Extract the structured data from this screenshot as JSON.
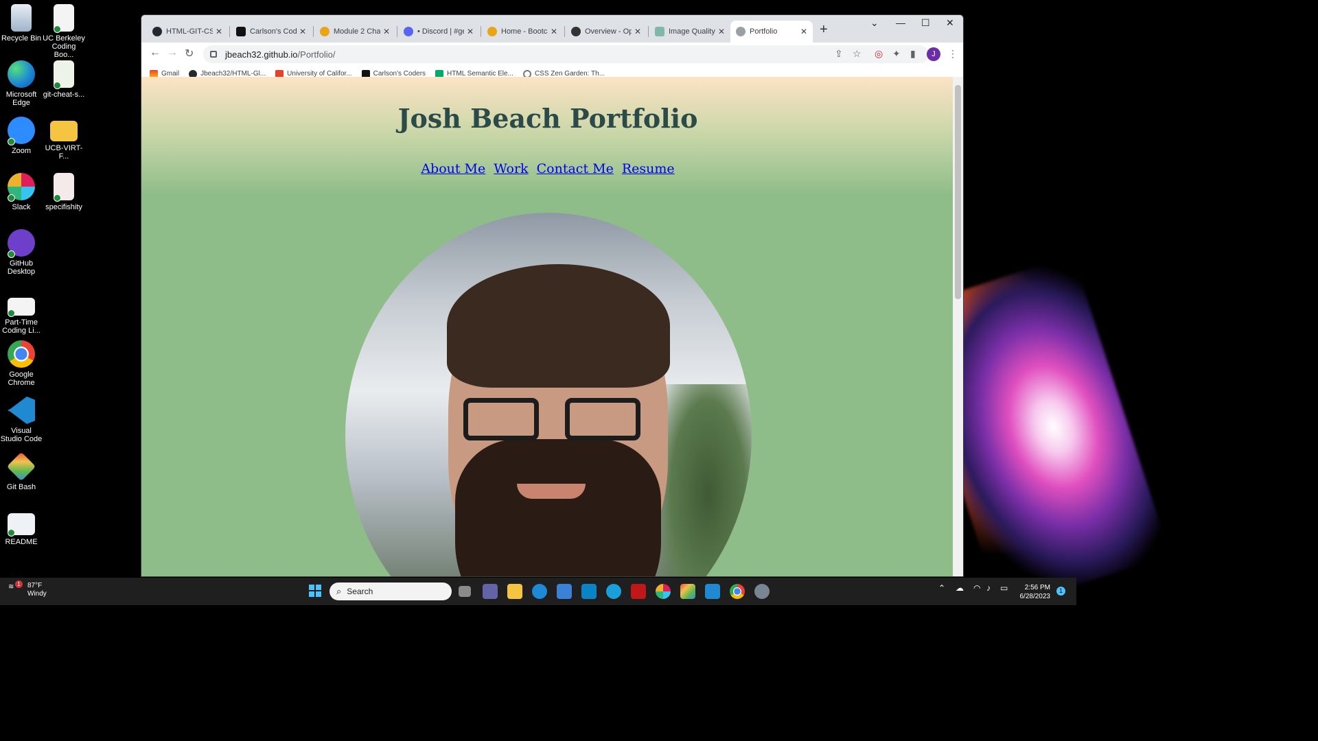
{
  "desktop": {
    "icons": [
      {
        "label": "Recycle Bin"
      },
      {
        "label": "UC Berkeley Coding Boo..."
      },
      {
        "label": "Microsoft Edge"
      },
      {
        "label": "git-cheat-s..."
      },
      {
        "label": "Zoom"
      },
      {
        "label": "UCB-VIRT-F..."
      },
      {
        "label": "Slack"
      },
      {
        "label": "specifishity"
      },
      {
        "label": "GitHub Desktop"
      },
      {
        "label": "Part-Time Coding Li..."
      },
      {
        "label": "Google Chrome"
      },
      {
        "label": "Visual Studio Code"
      },
      {
        "label": "Git Bash"
      },
      {
        "label": "README"
      }
    ]
  },
  "browser": {
    "tabs": [
      {
        "title": "HTML-GIT-CSS-"
      },
      {
        "title": "Carlson's Coder"
      },
      {
        "title": "Module 2 Challe"
      },
      {
        "title": "• Discord | #gen"
      },
      {
        "title": "Home - Bootcar"
      },
      {
        "title": "Overview - Ope"
      },
      {
        "title": "Image Quality"
      },
      {
        "title": "Portfolio"
      }
    ],
    "url_host": "jbeach32.github.io",
    "url_path": "/Portfolio/",
    "profile_initial": "J",
    "bookmarks": [
      {
        "label": "Gmail"
      },
      {
        "label": "Jbeach32/HTML-Gl..."
      },
      {
        "label": "University of Califor..."
      },
      {
        "label": "Carlson's Coders"
      },
      {
        "label": "HTML Semantic Ele..."
      },
      {
        "label": "CSS Zen Garden: Th..."
      }
    ]
  },
  "page": {
    "title": "Josh Beach Portfolio",
    "nav": [
      "About Me",
      "Work",
      "Contact Me",
      "Resume"
    ]
  },
  "taskbar": {
    "temperature": "87°F",
    "weather": "Windy",
    "weather_badge": "1",
    "search_placeholder": "Search",
    "time": "2:56 PM",
    "date": "6/28/2023",
    "notification_count": "1"
  },
  "colors": {
    "page_green": "#8fbd8a",
    "header_peach": "#fce3c4",
    "title_color": "#2c4a48",
    "link_blue": "#0000ee"
  }
}
